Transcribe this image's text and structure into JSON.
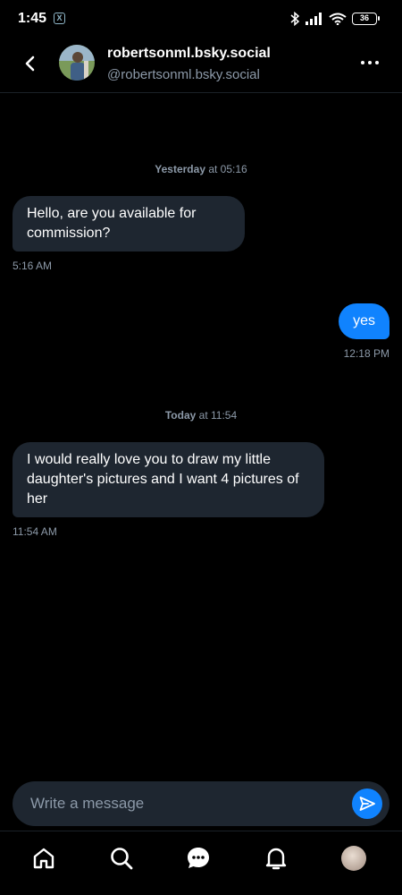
{
  "status_bar": {
    "time": "1:45",
    "app_badge": "X",
    "battery": "36"
  },
  "header": {
    "display_name": "robertsonml.bsky.social",
    "handle": "@robertsonml.bsky.social"
  },
  "messages": [
    {
      "type": "date",
      "day": "Yesterday",
      "rest": " at 05:16"
    },
    {
      "type": "incoming",
      "text": "Hello, are you available for commission?",
      "time": "5:16 AM"
    },
    {
      "type": "outgoing",
      "text": "yes",
      "time": "12:18 PM"
    },
    {
      "type": "date",
      "day": "Today",
      "rest": " at 11:54"
    },
    {
      "type": "incoming",
      "text": "I would really love you to draw my little daughter's pictures and I want 4 pictures of her",
      "time": "11:54 AM"
    }
  ],
  "composer": {
    "placeholder": "Write a message"
  },
  "nav": [
    "home-icon",
    "search-icon",
    "chat-icon",
    "bell-icon",
    "profile-avatar"
  ],
  "colors": {
    "background": "#000000",
    "bubble_incoming": "#1e2630",
    "bubble_outgoing": "#1083fe",
    "muted_text": "#8c99a8"
  }
}
